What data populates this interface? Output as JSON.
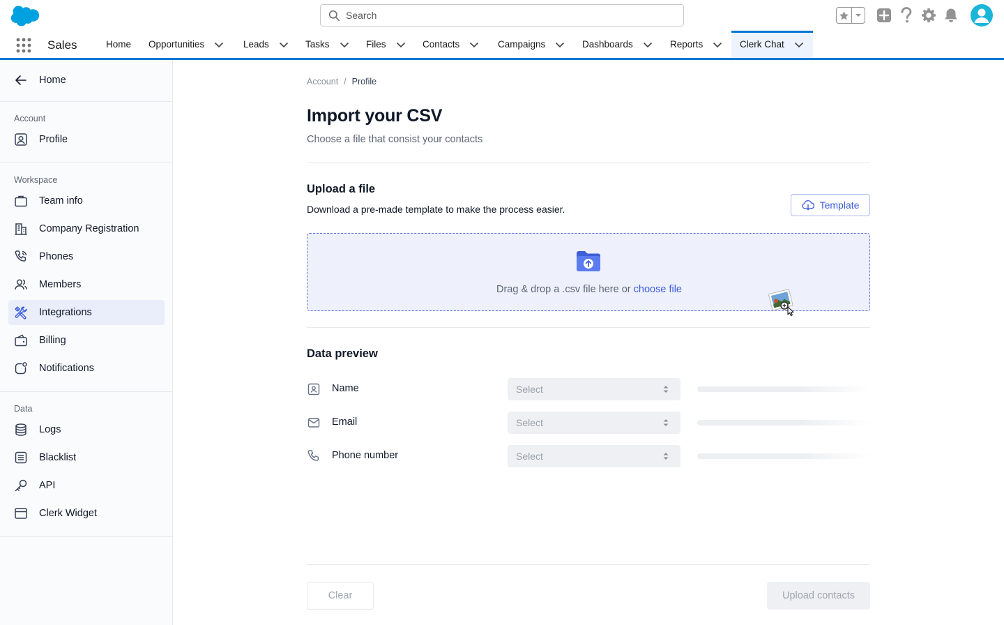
{
  "header": {
    "search_placeholder": "Search",
    "icons": [
      "salesforce-cloud-logo",
      "favorites-star-icon",
      "chevron-down-icon",
      "add-icon",
      "help-icon",
      "gear-icon",
      "bell-icon",
      "avatar-user-icon"
    ],
    "brand_color": "#0176d3"
  },
  "appnav": {
    "app_name": "Sales",
    "items": [
      {
        "label": "Home",
        "has_menu": false
      },
      {
        "label": "Opportunities",
        "has_menu": true
      },
      {
        "label": "Leads",
        "has_menu": true
      },
      {
        "label": "Tasks",
        "has_menu": true
      },
      {
        "label": "Files",
        "has_menu": true
      },
      {
        "label": "Contacts",
        "has_menu": true
      },
      {
        "label": "Campaigns",
        "has_menu": true
      },
      {
        "label": "Dashboards",
        "has_menu": true
      },
      {
        "label": "Reports",
        "has_menu": true
      },
      {
        "label": "Clerk Chat",
        "has_menu": true,
        "active": true
      }
    ]
  },
  "sidebar": {
    "back_label": "Home",
    "sections": [
      {
        "title": "Account",
        "items": [
          {
            "label": "Profile",
            "icon": "profile-icon"
          }
        ]
      },
      {
        "title": "Workspace",
        "items": [
          {
            "label": "Team info",
            "icon": "briefcase-icon"
          },
          {
            "label": "Company Registration",
            "icon": "building-icon"
          },
          {
            "label": "Phones",
            "icon": "phone-icon"
          },
          {
            "label": "Members",
            "icon": "members-icon"
          },
          {
            "label": "Integrations",
            "icon": "tools-icon",
            "active": true
          },
          {
            "label": "Billing",
            "icon": "wallet-icon"
          },
          {
            "label": "Notifications",
            "icon": "notification-icon"
          }
        ]
      },
      {
        "title": "Data",
        "items": [
          {
            "label": "Logs",
            "icon": "database-icon"
          },
          {
            "label": "Blacklist",
            "icon": "list-icon"
          },
          {
            "label": "API",
            "icon": "key-icon"
          },
          {
            "label": "Clerk Widget",
            "icon": "widget-icon"
          }
        ]
      }
    ]
  },
  "main": {
    "breadcrumb": {
      "parent": "Account",
      "separator": "/",
      "current": "Profile"
    },
    "title": "Import your CSV",
    "subtitle": "Choose a file that consist your contacts",
    "upload": {
      "title": "Upload a file",
      "description": "Download a pre-made template to make the process easier.",
      "template_button": "Template",
      "dropzone_text": "Drag & drop a .csv file here or ",
      "dropzone_link": "choose file"
    },
    "preview": {
      "title": "Data preview",
      "rows": [
        {
          "label": "Name",
          "icon": "id-card-icon",
          "select": "Select"
        },
        {
          "label": "Email",
          "icon": "mail-icon",
          "select": "Select"
        },
        {
          "label": "Phone number",
          "icon": "phone-icon",
          "select": "Select"
        }
      ]
    },
    "buttons": {
      "clear": "Clear",
      "upload": "Upload contacts"
    }
  }
}
